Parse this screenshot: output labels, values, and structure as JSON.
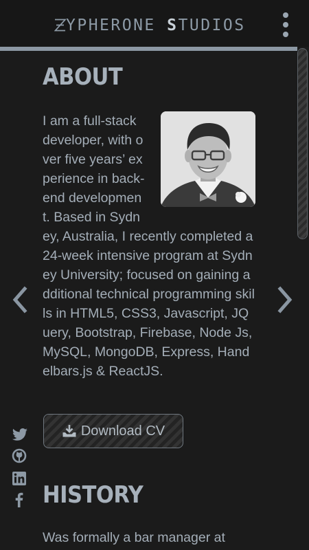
{
  "header": {
    "brand_z": "Z",
    "brand_first": "YPHERONE",
    "brand_s": "S",
    "brand_second": "TUDIOS"
  },
  "about": {
    "title": "ABOUT",
    "text": "I am a full-stack developer, with over five years’ experience in back-end development. Based in Sydney, Australia, I recently completed a 24-week intensive program at Sydney University; focused on gaining additional technical programming skills in HTML5, CSS3, Javascript, JQuery, Bootstrap, Firebase, Node Js, MySQL, MongoDB, Express, Handelbars.js & ReactJS."
  },
  "download": {
    "label": "Download CV"
  },
  "history": {
    "title": "HISTORY",
    "text": "Was formally a bar manager at"
  },
  "icons": {
    "menu": "dots-vertical-icon",
    "prev": "chevron-left-icon",
    "next": "chevron-right-icon",
    "twitter": "twitter-icon",
    "github": "github-icon",
    "linkedin": "linkedin-icon",
    "facebook": "facebook-icon",
    "download": "download-icon"
  },
  "colors": {
    "background": "#1b1b1b",
    "text": "#a4aeb8",
    "accent_line": "#8c98a3"
  }
}
